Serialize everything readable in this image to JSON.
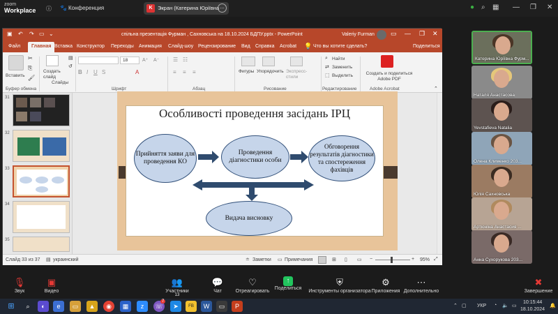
{
  "zoom": {
    "logo_line1": "zoom",
    "logo_line2": "Workplace",
    "conference_label": "Конференция",
    "share_title": "Экран (Катерина Юріївна Фурк",
    "share_badge": "K"
  },
  "ppt": {
    "window_title": "спільна презентація Фурман , Сахновська на 18.10.2024 БДПУ.pptx  -  PowerPoint",
    "user_name": "Valeriy Furman",
    "tabs": [
      "Файл",
      "Главная",
      "Вставка",
      "Конструктор",
      "Переходы",
      "Анимация",
      "Слайд-шоу",
      "Рецензирование",
      "Вид",
      "Справка",
      "Acrobat"
    ],
    "tell_me": "Что вы хотите сделать?",
    "share_btn": "Поделиться",
    "ribbon": {
      "paste": "Вставить",
      "new_slide": "Создать слайд",
      "slides_btn": "Слайды",
      "clipboard_group": "Буфер обмена",
      "slides_group": "Слайды",
      "font_group": "Шрифт",
      "paragraph_group": "Абзац",
      "drawing_group": "Рисование",
      "shapes": "Фигуры",
      "arrange": "Упорядочить",
      "quick_styles": "Экспресс-стили",
      "find": "Найти",
      "replace": "Заменить",
      "select": "Выделить",
      "edit_group": "Редактирование",
      "create_pdf": "Создать и поделиться Adobe PDF",
      "acrobat_group": "Adobe Acrobat",
      "font_size": "18"
    },
    "thumb_numbers": [
      "31",
      "32",
      "33",
      "34",
      "35"
    ],
    "status": {
      "slide_info": "Слайд 33 из 37",
      "language": "украинский",
      "notes": "Заметки",
      "comments": "Примечания",
      "zoom_level": "95%"
    }
  },
  "slide": {
    "title": "Особливості проведення засідань ІРЦ",
    "node1": "Прийняття заяви для проведення КО",
    "node2": "Проведення діагностики особи",
    "node3": "Обговорення результатів діагностики та спостереження фахівців",
    "node4": "Видача висновку"
  },
  "participants": [
    {
      "name": "Катерина Юріївна Фурм...",
      "bg": "#6b6f5c",
      "hair": "#4a3526"
    },
    {
      "name": "Наталя Анастасова",
      "bg": "#8a8a8a",
      "hair": "#e5c77a"
    },
    {
      "name": "Yevstafieva Natalia",
      "bg": "#5d5350",
      "hair": "#2a1d1a"
    },
    {
      "name": "Олена Клименко 203...",
      "bg": "#8fa5b8",
      "hair": "#6a5443"
    },
    {
      "name": "Юлія Сахновська",
      "bg": "#9b7b62",
      "hair": "#3b2c22"
    },
    {
      "name": "Артюніна Анастасия ...",
      "bg": "#b7a494",
      "hair": "#b08a5e"
    },
    {
      "name": "Анна Сухорукова 203...",
      "bg": "#7a6a68",
      "hair": "#3a2a25"
    }
  ],
  "zoom_bar": {
    "audio": "Звук",
    "video": "Видео",
    "participants": "Участники",
    "participants_count": "13",
    "chat": "Чат",
    "react": "Отреагировать",
    "share": "Поделиться",
    "host_tools": "Инструменты организатора",
    "apps": "Приложения",
    "more": "Дополнительно",
    "end": "Завершение"
  },
  "taskbar": {
    "lang": "УКР",
    "time": "10:15:44",
    "date": "18.10.2024",
    "badge": "7"
  }
}
